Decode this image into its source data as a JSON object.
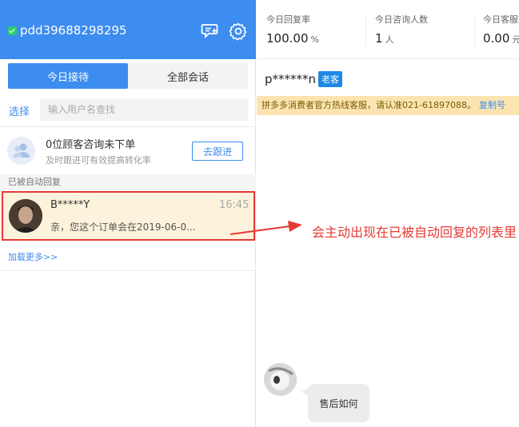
{
  "left_panel": {
    "account": "pdd39688298295",
    "tabs": [
      {
        "label": "今日接待",
        "active": true
      },
      {
        "label": "全部会话",
        "active": false
      }
    ],
    "select_label": "选择",
    "search_placeholder": "输入用户名查找",
    "consult": {
      "title": "0位顾客咨询未下单",
      "subtitle": "及时跟进可有效提高转化率",
      "button": "去跟进"
    },
    "section_label": "已被自动回复",
    "session": {
      "name": "B*****Y",
      "time": "16:45",
      "message": "亲，您这个订单会在2019-06-0..."
    },
    "load_more": "加载更多>>"
  },
  "right_panel": {
    "stats": [
      {
        "label": "今日回复率",
        "value": "100.00",
        "unit": "%"
      },
      {
        "label": "今日咨询人数",
        "value": "1",
        "unit": "人"
      },
      {
        "label": "今日客服",
        "value": "0.00",
        "unit": "元"
      }
    ],
    "customer": {
      "name": "p******n",
      "badge": "老客"
    },
    "notice": {
      "text": "拼多多消费者官方热线客服，请认准021-61897088。",
      "link": "复制号"
    },
    "message": "售后如何"
  },
  "annotation": {
    "text": "会主动出现在已被自动回复的列表里",
    "color": "#e53935"
  },
  "colors": {
    "brand_blue": "#3d8cf0",
    "highlight_bg": "#fdf3dc",
    "notice_bg": "#fbe4b0",
    "badge_blue": "#1e88e5",
    "online_green": "#2ecc71"
  }
}
